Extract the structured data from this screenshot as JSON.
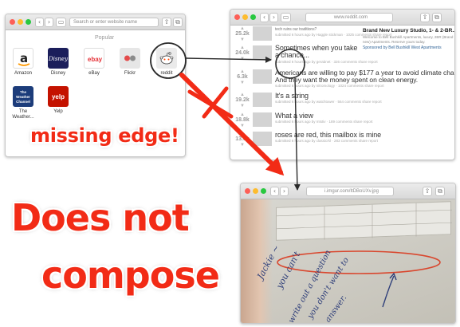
{
  "favorites_window": {
    "url_placeholder": "Search or enter website name",
    "section_label": "Popular",
    "sites": [
      {
        "label": "Amazon",
        "tile_text": "a",
        "bg": "#ffffff",
        "fg": "#222222"
      },
      {
        "label": "Disney",
        "tile_text": "Disney",
        "bg": "#1b1e5b",
        "fg": "#ffffff"
      },
      {
        "label": "eBay",
        "tile_text": "ebay",
        "bg": "#ffffff",
        "fg": "#e53238"
      },
      {
        "label": "Flickr",
        "tile_text": "",
        "bg": "#e6e6e6",
        "fg": "#0063dc"
      },
      {
        "label": "reddit",
        "tile_text": "",
        "bg": "#ffffff",
        "fg": "#ff4500"
      },
      {
        "label": "The Weather...",
        "tile_text": "The Weather Channel",
        "bg": "#1c3c7a",
        "fg": "#ffffff"
      },
      {
        "label": "Yelp",
        "tile_text": "yelp",
        "bg": "#c41200",
        "fg": "#ffffff"
      }
    ]
  },
  "reddit_window": {
    "url": "www.reddit.com",
    "posts": [
      {
        "score": "25.2k",
        "title": "tech ruins our traditions?",
        "meta": "submitted 6 hours ago by Haggle stickman · 1025 comments share report"
      },
      {
        "score": "24.0k",
        "title": "Sometimes when you take a chance...",
        "meta": "submitted 6 hours ago by gerabnet · 326 comments share report"
      },
      {
        "score": "6.3k",
        "title": "Americans are willing to pay $177 a year to avoid climate change:",
        "title2": "And they want the money spent on clean energy.",
        "meta": "submitted 6 hours ago by nitromology · 1024 comments share report"
      },
      {
        "score": "19.2k",
        "title": "It's a string",
        "meta": "submitted 6 hours ago by watchtower · 564 comments share report"
      },
      {
        "score": "18.8k",
        "title": "What a view",
        "meta": "submitted 6 hours ago by mtstiv · 189 comments share report"
      },
      {
        "score": "13.8k",
        "title": "roses are red, this mailbox is mine",
        "meta": "submitted 6 hours ago by classicrkl · 283 comments share report"
      }
    ],
    "ad": {
      "title": "Brand New Luxury Studio, 1- & 2-BR...",
      "body": "Welcome to Bell Bushkill Apartments, luxury, 2BR (Brand new) Apartments. Reserve yours today.",
      "sponsor": "Sponsored by Bell Bushkill West Apartments"
    }
  },
  "photo_window": {
    "url": "i.imgur.com/ItDBoUXv.jpg",
    "handwriting": [
      "Jackie ~",
      "you can't",
      "write out a question",
      "you don't want to",
      "answer."
    ]
  },
  "annotations": {
    "missing_edge": "missing edge!",
    "does_not": "Does not",
    "compose": "compose"
  },
  "colors": {
    "accent_red": "#f22b16",
    "arrow_dark": "#2a2a2a",
    "ellipse_red": "#d9472e"
  }
}
